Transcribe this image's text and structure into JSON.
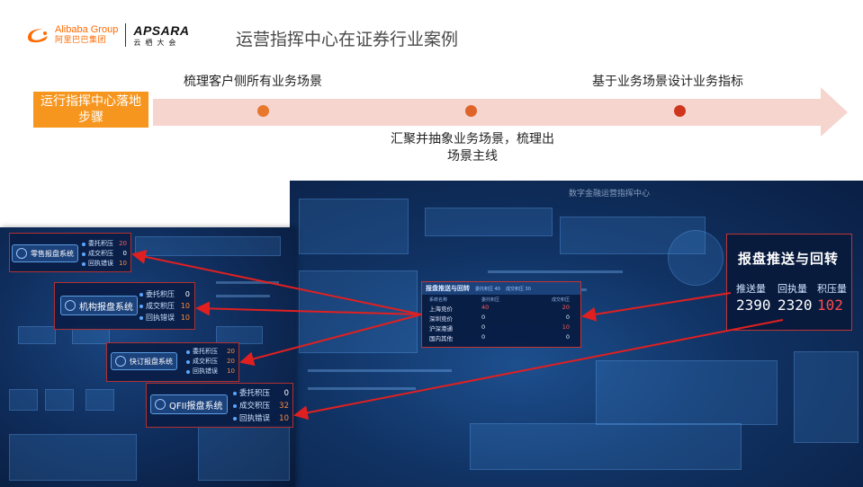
{
  "header": {
    "alibaba_en": "Alibaba Group",
    "alibaba_cn": "阿里巴巴集团",
    "apsara_en": "APSARA",
    "apsara_cn": "云栖大会",
    "title": "运营指挥中心在证券行业案例"
  },
  "process": {
    "step_label": "运行指挥中心落地步骤",
    "milestones": [
      {
        "text": "梳理客户侧所有业务场景",
        "color": "#e8762b"
      },
      {
        "text": "汇聚并抽象业务场景，梳理出场景主线",
        "color": "#e0642a"
      },
      {
        "text": "基于业务场景设计业务指标",
        "color": "#d0361e"
      }
    ],
    "arrow_color": "#f6d5cf"
  },
  "systems": [
    {
      "name": "零售报盘系统",
      "metrics": [
        {
          "label": "委托积压",
          "value": "20",
          "tone": "red"
        },
        {
          "label": "成交积压",
          "value": "0",
          "tone": "white"
        },
        {
          "label": "回执错误",
          "value": "10",
          "tone": "orange"
        }
      ]
    },
    {
      "name": "机构报盘系统",
      "metrics": [
        {
          "label": "委托积压",
          "value": "0",
          "tone": "white"
        },
        {
          "label": "成交积压",
          "value": "10",
          "tone": "orange"
        },
        {
          "label": "回执错误",
          "value": "10",
          "tone": "orange"
        }
      ]
    },
    {
      "name": "快订报盘系统",
      "metrics": [
        {
          "label": "委托积压",
          "value": "20",
          "tone": "orange"
        },
        {
          "label": "成交积压",
          "value": "20",
          "tone": "orange"
        },
        {
          "label": "回执错误",
          "value": "10",
          "tone": "orange"
        }
      ]
    },
    {
      "name": "QFII报盘系统",
      "metrics": [
        {
          "label": "委托积压",
          "value": "0",
          "tone": "white"
        },
        {
          "label": "成交积压",
          "value": "32",
          "tone": "orange"
        },
        {
          "label": "回执错误",
          "value": "10",
          "tone": "orange"
        }
      ]
    }
  ],
  "center_table": {
    "title": "报盘推送与回转",
    "tag1": "委托积压 40",
    "tag2": "成交积压 30",
    "columns": [
      "系统名称",
      "委托积压",
      "成交积压"
    ],
    "rows": [
      {
        "name": "上海竞价",
        "a": "40",
        "b": "20",
        "a_red": true,
        "b_red": true
      },
      {
        "name": "深圳竞价",
        "a": "0",
        "b": "0",
        "a_red": false,
        "b_red": false
      },
      {
        "name": "沪深港通",
        "a": "0",
        "b": "10",
        "a_red": false,
        "b_red": true
      },
      {
        "name": "国内其他",
        "a": "0",
        "b": "0",
        "a_red": false,
        "b_red": false
      }
    ]
  },
  "big_callout": {
    "title": "报盘推送与回转",
    "labels": [
      "推送量",
      "回执量",
      "积压量"
    ],
    "values": [
      "2390",
      "2320",
      "102"
    ]
  },
  "dashboard": {
    "title": "数字金融运营指挥中心"
  },
  "colors": {
    "orange": "#f7961e",
    "dash_bg": "#0f2d5c",
    "alert_red": "#e02020"
  }
}
